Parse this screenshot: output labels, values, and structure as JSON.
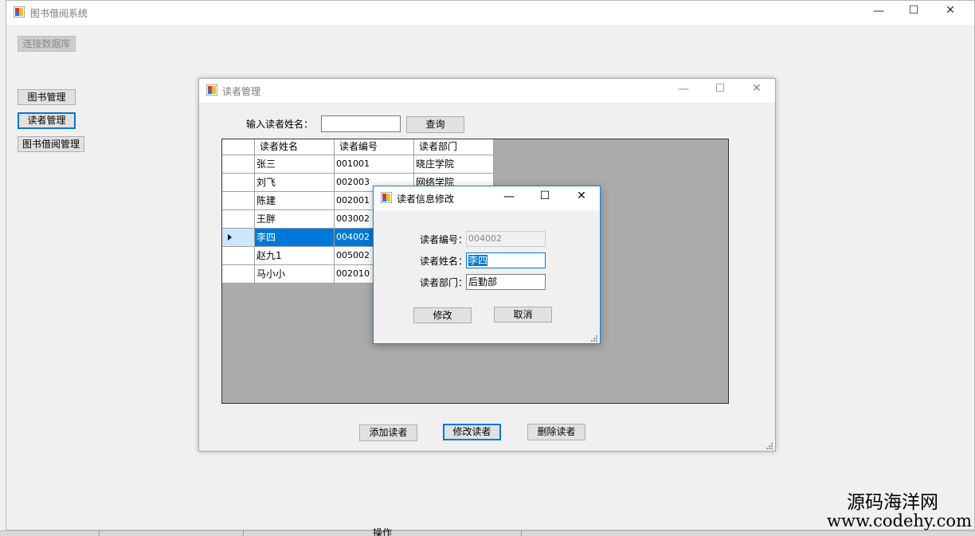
{
  "main_window": {
    "title": "图书借阅系统",
    "connect_db_button": "连接数据库",
    "nav_buttons": [
      "图书管理",
      "读者管理",
      "图书借阅管理"
    ]
  },
  "reader_window": {
    "title": "读者管理",
    "search_label": "输入读者姓名：",
    "search_value": "",
    "search_button": "查询",
    "table": {
      "columns": [
        "读者姓名",
        "读者编号",
        "读者部门"
      ],
      "rows": [
        [
          "张三",
          "001001",
          "晓庄学院"
        ],
        [
          "刘飞",
          "002003",
          "网络学院"
        ],
        [
          "陈建",
          "002001",
          ""
        ],
        [
          "王胖",
          "003002",
          ""
        ],
        [
          "李四",
          "004002",
          ""
        ],
        [
          "赵九1",
          "005002",
          ""
        ],
        [
          "马小小",
          "002010",
          ""
        ]
      ],
      "selected_row": 4
    },
    "buttons": {
      "add": "添加读者",
      "edit": "修改读者",
      "delete": "删除读者"
    }
  },
  "edit_dialog": {
    "title": "读者信息修改",
    "id_label": "读者编号：",
    "id_value": "004002",
    "name_label": "读者姓名：",
    "name_value": "李四",
    "dept_label": "读者部门：",
    "dept_value": "后勤部",
    "ok_button": "修改",
    "cancel_button": "取消"
  },
  "taskbar": {
    "partial_text": "操作"
  },
  "watermark": {
    "line1": "源码海洋网",
    "line2": "www.codehy.com"
  },
  "colors": {
    "accent": "#0078d7",
    "grid_bg": "#ababab",
    "selected_row_header": "#cce8ff"
  }
}
